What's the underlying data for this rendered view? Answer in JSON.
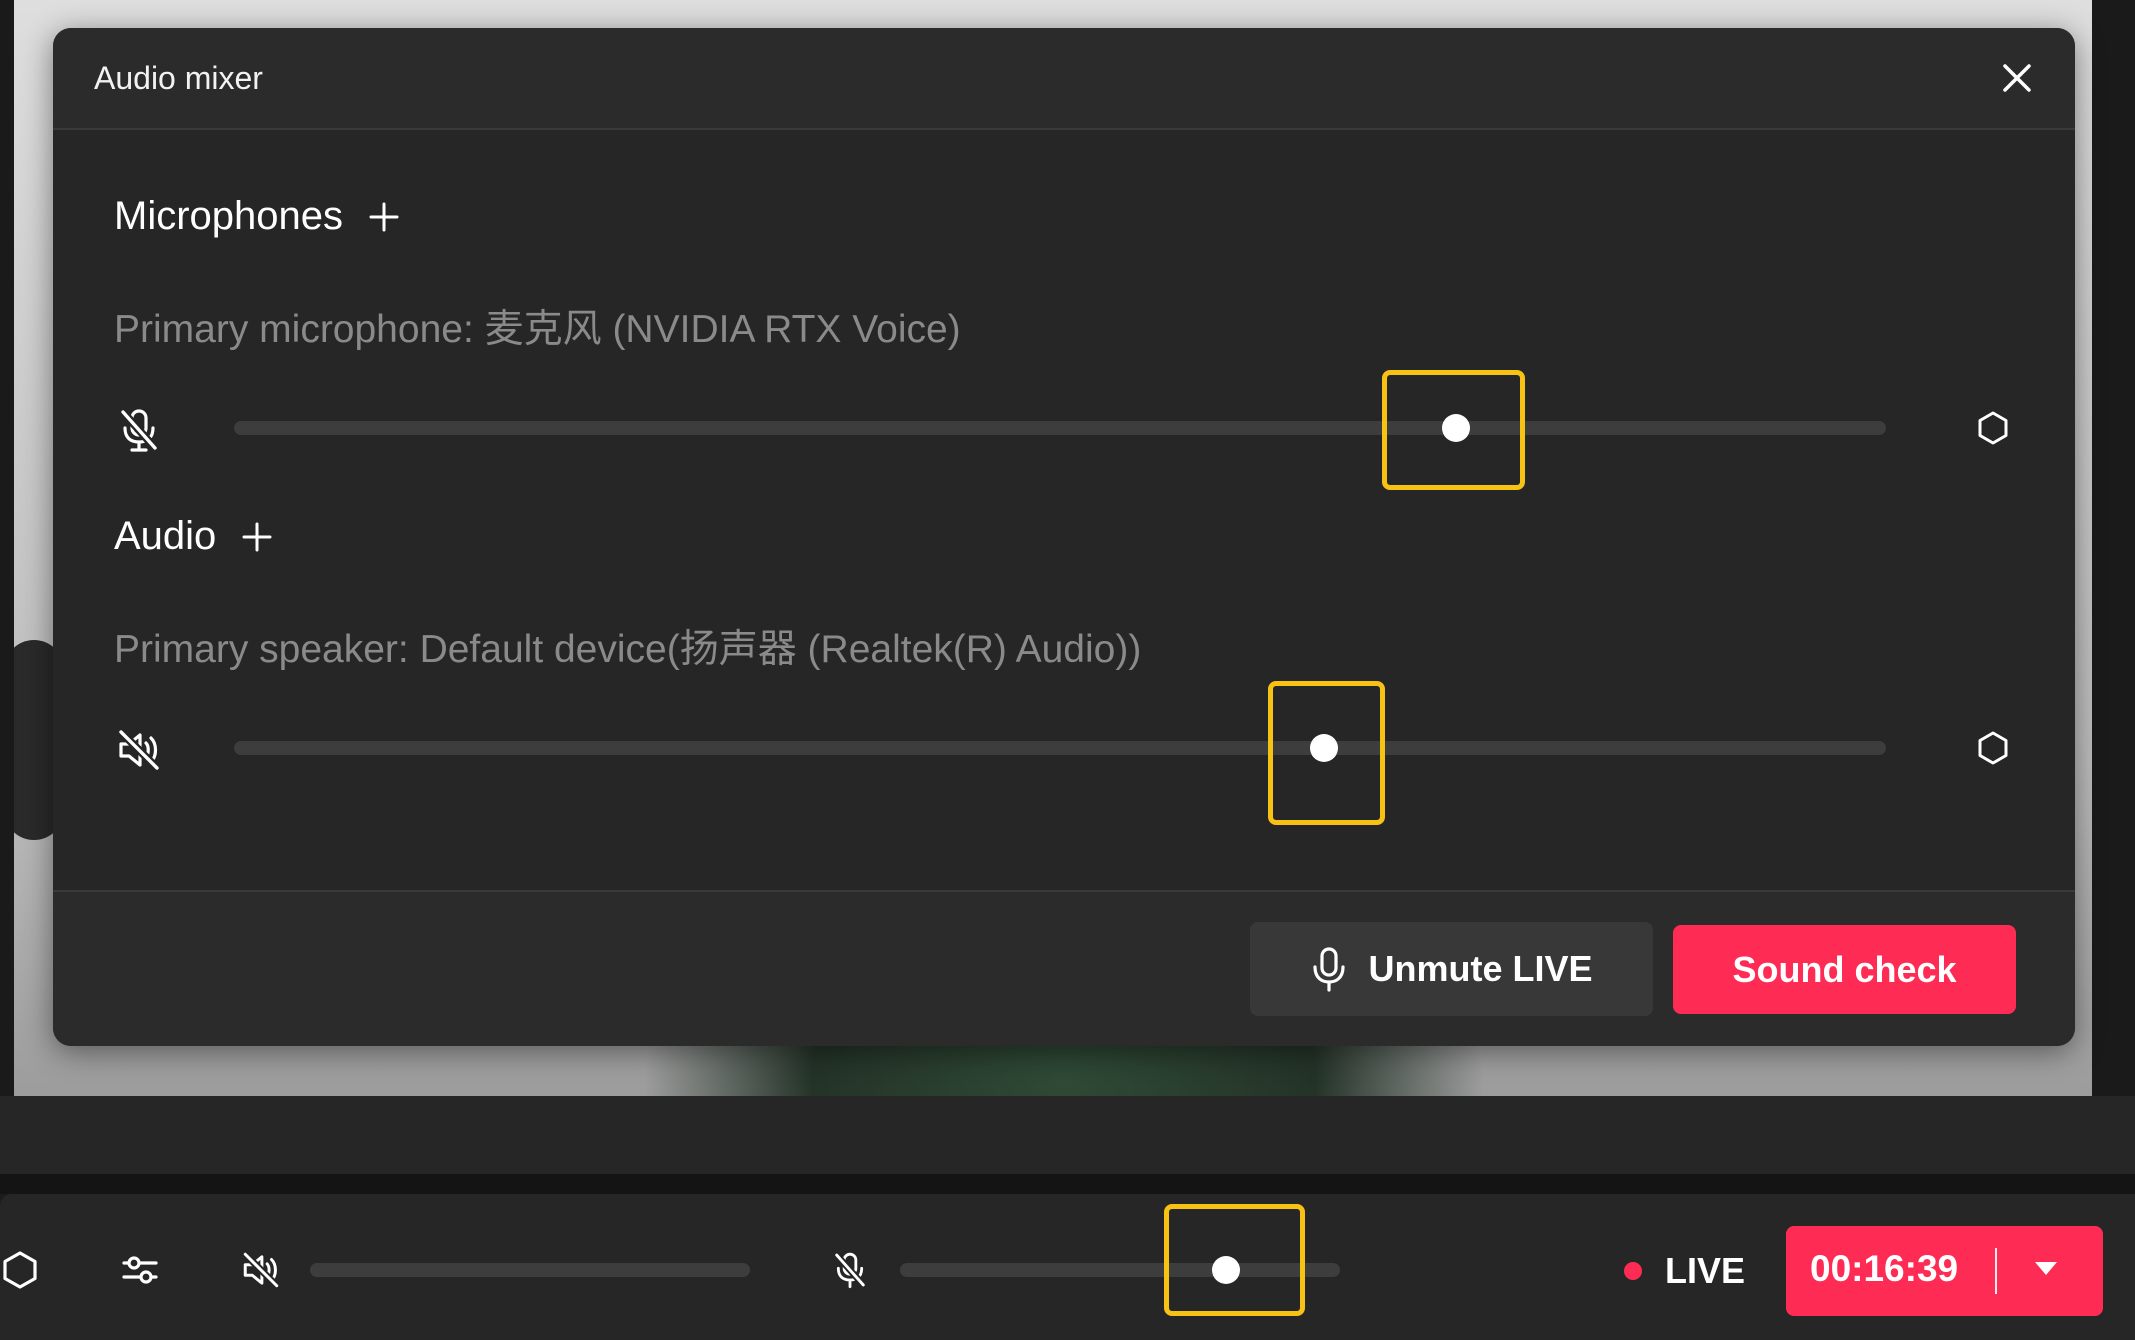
{
  "dialog": {
    "title": "Audio mixer",
    "microphones": {
      "title": "Microphones",
      "device_label": "Primary microphone: 麦克风 (NVIDIA RTX Voice)",
      "volume_fraction": 0.74
    },
    "audio": {
      "title": "Audio",
      "device_label": "Primary speaker: Default device(扬声器 (Realtek(R) Audio))",
      "volume_fraction": 0.66
    },
    "footer": {
      "unmute_label": "Unmute LIVE",
      "sound_check_label": "Sound check"
    }
  },
  "bottombar": {
    "speaker_volume_fraction": 0.0,
    "mic_volume_fraction": 0.74,
    "live_label": "LIVE",
    "timer": "00:16:39"
  },
  "colors": {
    "accent": "#fe2c55",
    "highlight": "#f7c214",
    "panel": "#262626",
    "muted_text": "#8a8a8a"
  },
  "icons": [
    "close-icon",
    "plus-icon",
    "mic-muted-icon",
    "speaker-muted-icon",
    "gear-icon",
    "microphone-icon",
    "sliders-icon",
    "chevron-down-icon"
  ]
}
